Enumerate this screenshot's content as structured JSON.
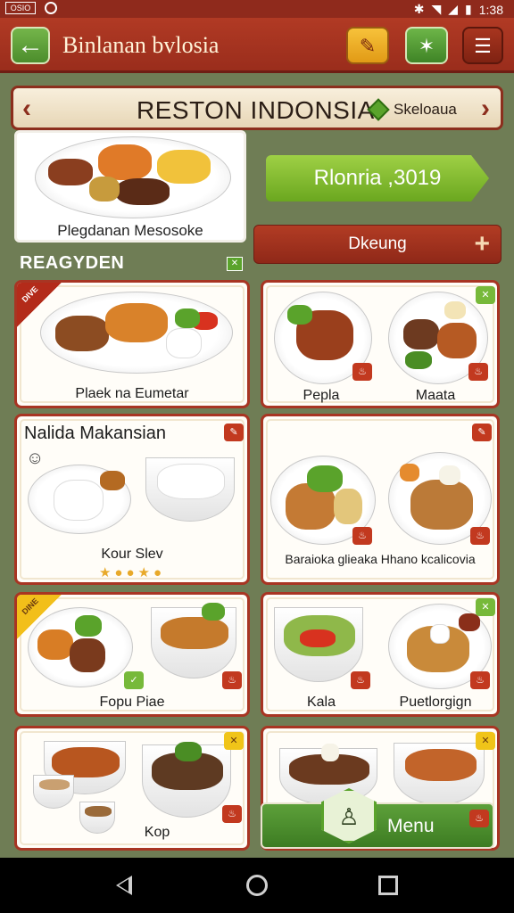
{
  "status_bar": {
    "time": "1:38",
    "left_badge": "OSIO"
  },
  "app_bar": {
    "title": "Binlanan bvlosia",
    "back_icon": "arrow-left-icon",
    "edit_icon": "brush-icon",
    "star_icon": "star-icon",
    "menu_icon": "list-icon"
  },
  "banner": {
    "title": "RESTON INDONSIA",
    "tag": "Skeloaua"
  },
  "featured": {
    "label": "Plegdanan Mesosoke"
  },
  "price_button": {
    "label": "Rlonria ,3019"
  },
  "detail_bar": {
    "label": "Dkeung"
  },
  "section": {
    "label": "REAGYDEN"
  },
  "cards": [
    {
      "label": "Plaek na Eumetar",
      "ribbon": "DIVE"
    },
    {
      "label_left": "Pepla",
      "label_right": "Maata"
    },
    {
      "title": "Nalida Makansian",
      "label": "Kour Slev"
    },
    {
      "label": "Baraioka glieaka  Hhano kcalicovia"
    },
    {
      "label": "Fopu Piae",
      "ribbon": "DINE"
    },
    {
      "label_left": "Kala",
      "label_right": "Puetlorgign"
    },
    {
      "label": "Kop"
    },
    {
      "label": ""
    }
  ],
  "menu_button": {
    "label": "Menu",
    "icon": "chef-icon"
  },
  "colors": {
    "primary_red": "#9a2d1c",
    "accent_green": "#6ba71f",
    "accent_yellow": "#f2bf1a",
    "background": "#6f7d55"
  }
}
